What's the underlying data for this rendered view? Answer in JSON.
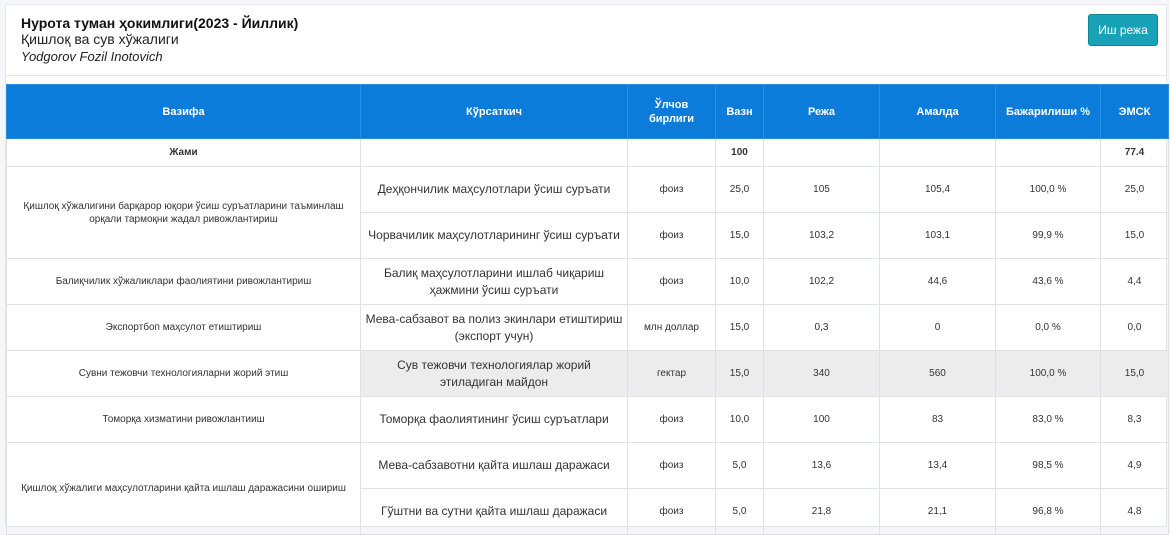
{
  "header": {
    "title": "Нурота туман ҳокимлиги(2023 - Йиллик)",
    "subtitle": "Қишлоқ ва сув хўжалиги",
    "person": "Yodgorov Fozil Inotovich",
    "plan_button": "Иш режа"
  },
  "table": {
    "columns": [
      "Вазифа",
      "Кўрсаткич",
      "Ўлчов бирлиги",
      "Вазн",
      "Режа",
      "Амалда",
      "Бажарилиши %",
      "ЭМСК"
    ],
    "total": {
      "label": "Жами",
      "weight": "100",
      "emsk": "77.4"
    },
    "tasks": [
      "Қишлоқ хўжалигини барқарор юқори ўсиш суръатларини таъминлаш орқали тармоқни жадал ривожлантириш",
      "Балиқчилик хўжаликлари фаолиятини ривожлантириш",
      "Экспортбоп маҳсулот етиштириш",
      "Сувни тежовчи технологияларни жорий этиш",
      "Томорқа хизматини ривожлантииш",
      "Қишлоқ хўжалиги маҳсулотларини қайта ишлаш даражасини ошириш"
    ],
    "rows": [
      {
        "indicator": "Деҳқончилик маҳсулотлари ўсиш суръати",
        "unit": "фоиз",
        "weight": "25,0",
        "plan": "105",
        "actual": "105,4",
        "percent": "100,0 %",
        "emsk": "25,0"
      },
      {
        "indicator": "Чорвачилик маҳсулотларининг ўсиш суръати",
        "unit": "фоиз",
        "weight": "15,0",
        "plan": "103,2",
        "actual": "103,1",
        "percent": "99,9 %",
        "emsk": "15,0"
      },
      {
        "indicator": "Балиқ маҳсулотларини ишлаб чиқариш ҳажмини ўсиш суръати",
        "unit": "фоиз",
        "weight": "10,0",
        "plan": "102,2",
        "actual": "44,6",
        "percent": "43,6 %",
        "emsk": "4,4"
      },
      {
        "indicator": "Мева-сабзавот ва полиз экинлари етиштириш (экспорт учун)",
        "unit": "млн доллар",
        "weight": "15,0",
        "plan": "0,3",
        "actual": "0",
        "percent": "0,0 %",
        "emsk": "0,0"
      },
      {
        "indicator": "Сув тежовчи технологиялар жорий этиладиган майдон",
        "unit": "гектар",
        "weight": "15,0",
        "plan": "340",
        "actual": "560",
        "percent": "100,0 %",
        "emsk": "15,0"
      },
      {
        "indicator": "Томорқа фаолиятининг ўсиш суръатлари",
        "unit": "фоиз",
        "weight": "10,0",
        "plan": "100",
        "actual": "83",
        "percent": "83,0 %",
        "emsk": "8,3"
      },
      {
        "indicator": "Мева-сабзавотни қайта ишлаш даражаси",
        "unit": "фоиз",
        "weight": "5,0",
        "plan": "13,6",
        "actual": "13,4",
        "percent": "98,5 %",
        "emsk": "4,9"
      },
      {
        "indicator": "Гўштни ва сутни қайта ишлаш даражаси",
        "unit": "фоиз",
        "weight": "5,0",
        "plan": "21,8",
        "actual": "21,1",
        "percent": "96,8 %",
        "emsk": "4,8"
      }
    ]
  }
}
